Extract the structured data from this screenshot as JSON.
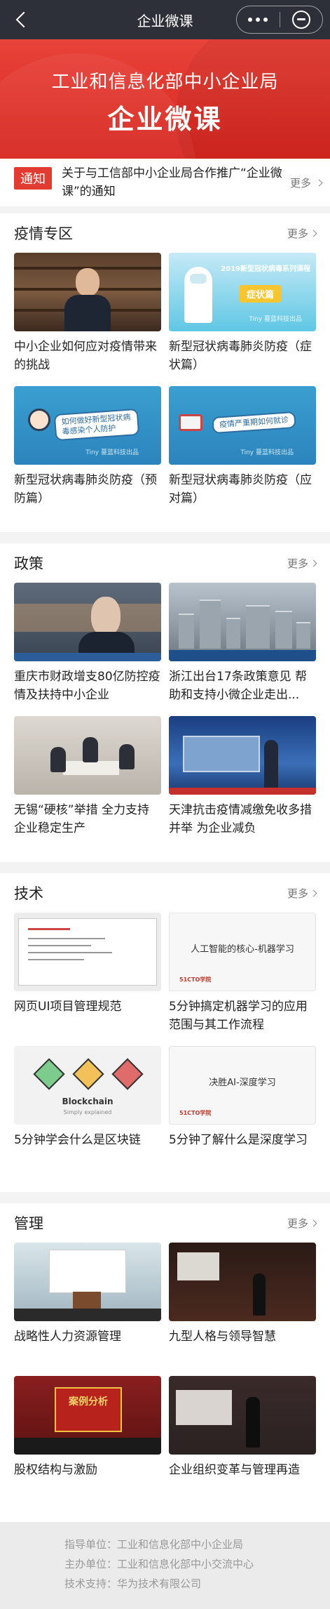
{
  "titlebar": {
    "title": "企业微课"
  },
  "banner": {
    "line1": "工业和信息化部中小企业局",
    "line2": "企业微课"
  },
  "notice": {
    "tag": "通知",
    "text": "关于与工信部中小企业局合作推广“企业微课”的通知",
    "more": "更多"
  },
  "sections": [
    {
      "title": "疫情专区",
      "more": "更多",
      "items": [
        {
          "caption": "中小企业如何应对疫情带来的挑战"
        },
        {
          "caption": "新型冠状病毒肺炎防疫（症状篇）",
          "thumb_text": "2019新型冠状病毒系列课程",
          "thumb_badge": "症状篇",
          "thumb_brand": "Tiny 蔓蓝科技出品"
        },
        {
          "caption": "新型冠状病毒肺炎防疫（预防篇）",
          "thumb_text": "如何做好新型冠状病毒感染个人防护",
          "thumb_brand": "Tiny 蔓蓝科技出品"
        },
        {
          "caption": "新型冠状病毒肺炎防疫（应对篇）",
          "thumb_text": "疫情严重期如何就诊",
          "thumb_brand": "Tiny 蔓蓝科技出品"
        }
      ]
    },
    {
      "title": "政策",
      "more": "更多",
      "items": [
        {
          "caption": "重庆市财政增支80亿防控疫情及扶持中小企业"
        },
        {
          "caption": "浙江出台17条政策意见 帮助和支持小微企业走出..."
        },
        {
          "caption": "无锡“硬核”举措 全力支持企业稳定生产"
        },
        {
          "caption": "天津抗击疫情减缴免收多措并举 为企业减负"
        }
      ]
    },
    {
      "title": "技术",
      "more": "更多",
      "items": [
        {
          "caption": "网页UI项目管理规范"
        },
        {
          "caption": "5分钟搞定机器学习的应用范围与其工作流程",
          "thumb_text": "人工智能的核心-机器学习",
          "thumb_logo": "51CTO学院"
        },
        {
          "caption": "5分钟学会什么是区块链",
          "thumb_text": "Blockchain",
          "thumb_sub": "Simply explained"
        },
        {
          "caption": "5分钟了解什么是深度学习",
          "thumb_text": "决胜AI-深度学习",
          "thumb_logo": "51CTO学院"
        }
      ]
    },
    {
      "title": "管理",
      "more": "更多",
      "items": [
        {
          "caption": "战略性人力资源管理"
        },
        {
          "caption": "九型人格与领导智慧"
        },
        {
          "caption": "股权结构与激励",
          "thumb_text": "案例分析"
        },
        {
          "caption": "企业组织变革与管理再造"
        }
      ]
    }
  ],
  "footer": {
    "guide": "指导单位：工业和信息化部中小企业局",
    "host": "主办单位：工业和信息化部中小交流中心",
    "support": "技术支持：华为技术有限公司"
  }
}
